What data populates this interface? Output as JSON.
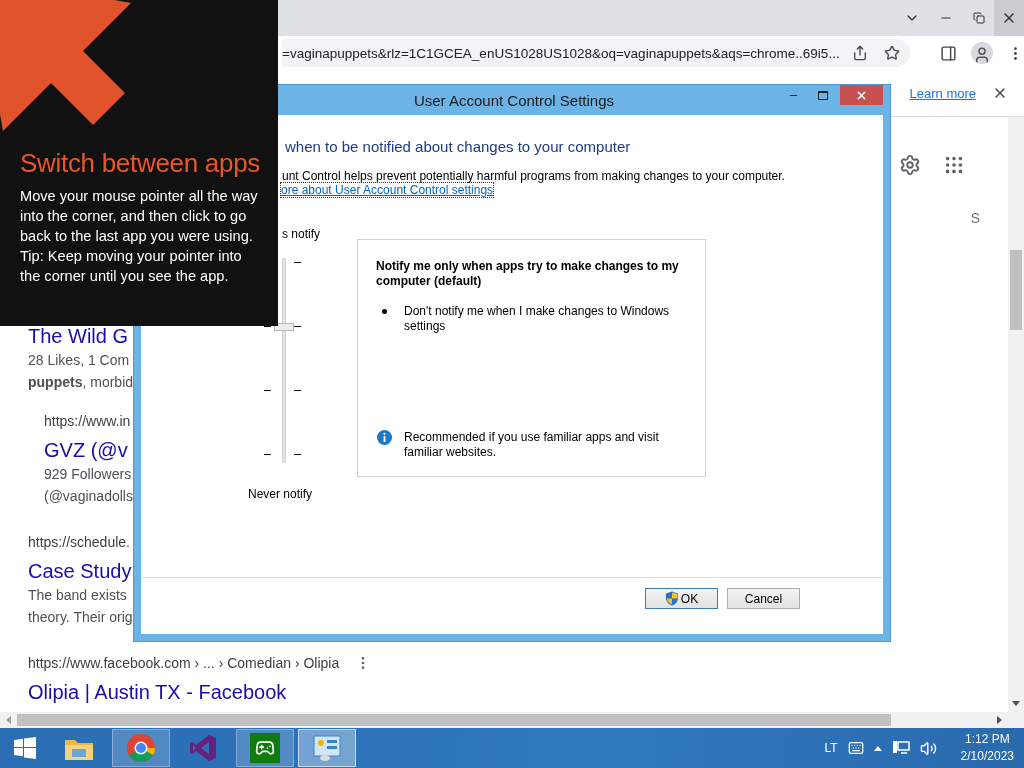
{
  "browser": {
    "address": "=vaginapuppets&rlz=1C1GCEA_enUS1028US1028&oq=vaginapuppets&aqs=chrome..69i5...",
    "infobar": {
      "link": "Learn more"
    },
    "side_label": "S",
    "results": [
      {
        "title": "The Wild G",
        "snippets": [
          "28 Likes, 1 Com",
          "**puppets**, morbid"
        ],
        "menu": false,
        "children": [
          {
            "url": "https://www.in",
            "title": "GVZ (@v",
            "snippets": [
              "929 Followers",
              "(@vaginadolls"
            ],
            "menu": false
          }
        ]
      },
      {
        "url": "https://schedule.",
        "title": "Case Study",
        "snippets": [
          "The band exists",
          "theory. Their orig"
        ],
        "menu": false
      },
      {
        "url": "https://www.facebook.com › ... › Comedian › Olipia",
        "title": "Olipia | Austin TX - Facebook",
        "menu": true
      }
    ]
  },
  "dialog": {
    "title": "User Account Control Settings",
    "heading": "when to be notified about changes to your computer",
    "description": "unt Control helps prevent potentially harmful programs from making changes to your computer.",
    "link": "ore about User Account Control settings",
    "top_label": "s notify",
    "bottom_label": "Never notify",
    "slider": {
      "level": 0.67
    },
    "info": {
      "title": "Notify me only when apps try to make changes to my computer (default)",
      "bullets": [
        "Don't notify me when I make changes to Windows settings"
      ],
      "note": "Recommended if you use familiar apps and visit familiar websites."
    },
    "buttons": [
      {
        "label": "OK",
        "kind": "shield"
      },
      {
        "label": "Cancel",
        "kind": "plain"
      }
    ]
  },
  "tip": {
    "title": "Switch between apps",
    "paragraphs": [
      "Move your mouse pointer all the way into the corner, and then click to go back to the last app you were using.",
      "Tip: Keep moving your pointer into the corner until you see the app."
    ]
  },
  "taskbar": {
    "apps": [
      {
        "kind": "explorer",
        "open": false,
        "selected": false
      },
      {
        "kind": "chrome",
        "open": true,
        "selected": false
      },
      {
        "kind": "studio",
        "open": false,
        "selected": false
      },
      {
        "kind": "games",
        "open": true,
        "selected": false
      },
      {
        "kind": "control",
        "open": true,
        "selected": true
      }
    ],
    "language": "LT",
    "time": "1:12 PM",
    "date": "2/10/2023"
  }
}
